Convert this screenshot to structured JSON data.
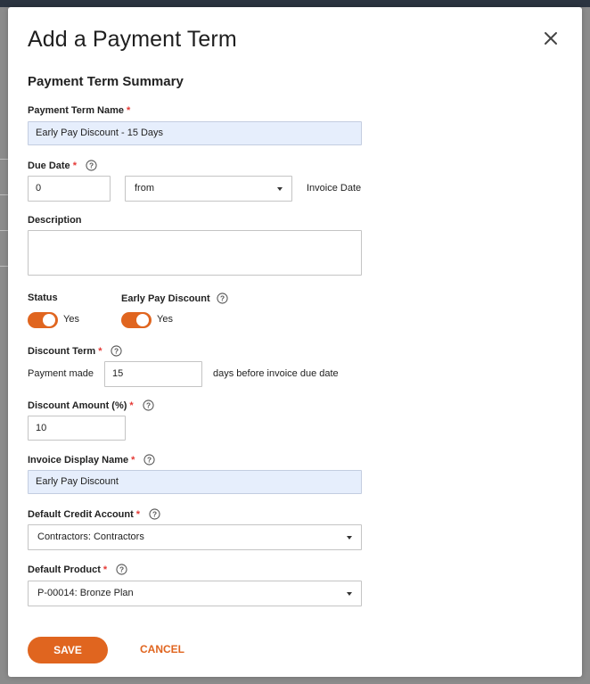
{
  "modal": {
    "title": "Add a Payment Term",
    "section_title": "Payment Term Summary"
  },
  "fields": {
    "payment_term_name": {
      "label": "Payment Term Name",
      "required": "*",
      "value": "Early Pay Discount - 15 Days"
    },
    "due_date": {
      "label": "Due Date",
      "required": "*",
      "value": "0",
      "relation": "from",
      "suffix": "Invoice Date"
    },
    "description": {
      "label": "Description",
      "value": ""
    },
    "status": {
      "label": "Status",
      "value_label": "Yes",
      "on": true
    },
    "early_pay_discount": {
      "label": "Early Pay Discount",
      "value_label": "Yes",
      "on": true
    },
    "discount_term": {
      "label": "Discount Term",
      "required": "*",
      "prefix": "Payment made",
      "value": "15",
      "suffix": "days before invoice due date"
    },
    "discount_amount": {
      "label": "Discount Amount (%)",
      "required": "*",
      "value": "10"
    },
    "invoice_display_name": {
      "label": "Invoice Display Name",
      "required": "*",
      "value": "Early Pay Discount"
    },
    "default_credit_account": {
      "label": "Default Credit Account",
      "required": "*",
      "value": "Contractors: Contractors"
    },
    "default_product": {
      "label": "Default Product",
      "required": "*",
      "value": "P-00014: Bronze Plan"
    }
  },
  "actions": {
    "save": "SAVE",
    "cancel": "CANCEL"
  },
  "icons": {
    "close": "close-icon",
    "help": "question-circle-icon",
    "dropdown": "caret-down-icon"
  },
  "colors": {
    "accent": "#e0651f",
    "required": "#e53935",
    "highlight_field": "#e6eefc"
  }
}
